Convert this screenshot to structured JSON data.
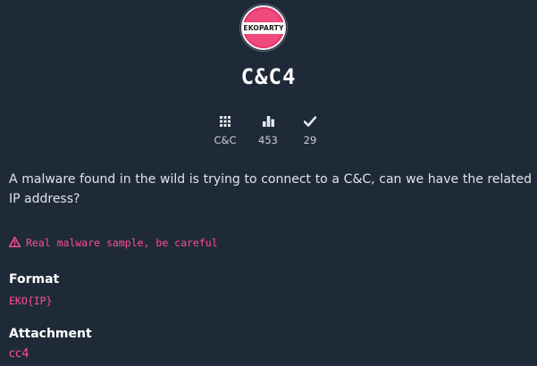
{
  "logo": {
    "text": "EKOPARTY"
  },
  "challenge": {
    "title": "C&C4"
  },
  "stats": {
    "category": "C&C",
    "points": "453",
    "solves": "29"
  },
  "description": "A malware found in the wild is trying to connect to a C&C, can we have the related IP address?",
  "warning": "Real malware sample, be careful",
  "format": {
    "heading": "Format",
    "value": "EKO{IP}"
  },
  "attachment": {
    "heading": "Attachment",
    "link": "cc4"
  },
  "colors": {
    "background": "#1f2a38",
    "accent": "#ff4d97",
    "text": "#dfe3ea"
  },
  "icons": {
    "category": "grid-icon",
    "points": "bar-chart-icon",
    "solves": "check-icon",
    "warning": "warning-triangle-icon"
  }
}
